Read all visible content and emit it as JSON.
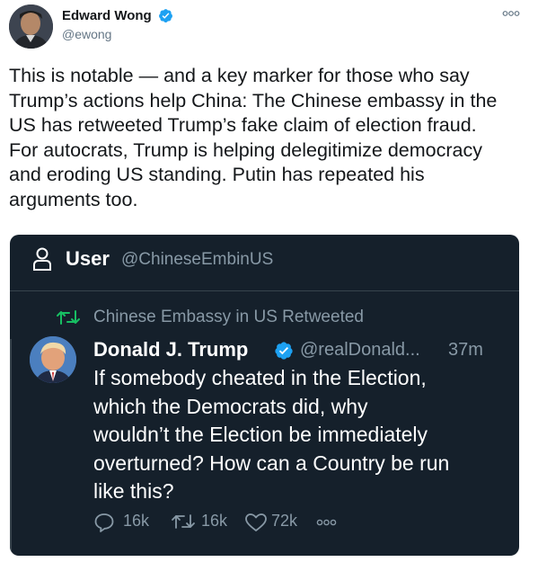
{
  "tweet": {
    "author_name": "Edward Wong",
    "author_handle": "@ewong",
    "text": "This is notable — and a key marker for those who say\nTrump’s actions help China: The Chinese embassy in the\nUS has retweeted Trump’s fake claim of election fraud.\nFor autocrats, Trump is helping delegitimize democracy\nand eroding US standing. Putin has repeated his\narguments too."
  },
  "embed": {
    "header_label": "User",
    "header_handle": "@ChineseEmbinUS",
    "retweet_text": "Chinese Embassy in US Retweeted",
    "quoted": {
      "name": "Donald J. Trump",
      "handle": "@realDonald...",
      "time": "37m",
      "text": "If somebody cheated in the Election,\nwhich the Democrats did, why\nwouldn’t the Election be immediately\noverturned? How can a Country be run\nlike this?",
      "replies": "16k",
      "retweets": "16k",
      "likes": "72k"
    }
  },
  "colors": {
    "verified": "#1da1f2",
    "retweet_green": "#17bf63",
    "dark_bg": "#15202b",
    "muted_dark": "#8899a6"
  },
  "icons": [
    "verified-badge-icon",
    "more-options-icon",
    "user-outline-icon",
    "retweet-icon",
    "reply-icon",
    "heart-icon"
  ]
}
